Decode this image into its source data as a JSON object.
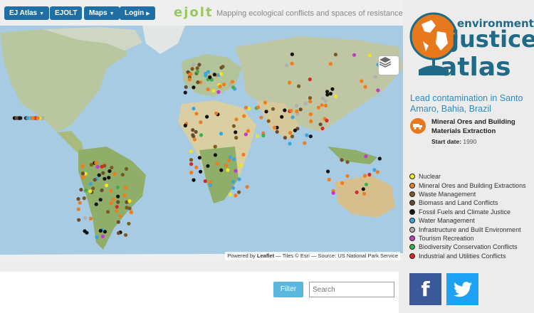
{
  "nav": {
    "ej_atlas": "EJ Atlas",
    "ejolt": "EJOLT",
    "maps": "Maps",
    "login": "Login"
  },
  "header": {
    "logo": "ejolt",
    "tagline": "Mapping ecological conflicts and spaces of resistance"
  },
  "map": {
    "layers_icon": "layers-icon",
    "attribution_prefix": "Powered by ",
    "attribution_leaflet": "Leaflet",
    "attribution_rest": " — Tiles © Esri — Source: US National Park Service"
  },
  "sidebar": {
    "logo_lines": [
      "environmental",
      "justice",
      "atlas"
    ],
    "conflict_title": "Lead contamination in Santo Amaro, Bahia, Brazil",
    "category": "Mineral Ores and Building Materials Extraction",
    "category_icon": "mining-truck-icon",
    "start_date_label": "Start date:",
    "start_date_value": "1990"
  },
  "legend": [
    {
      "label": "Nuclear",
      "color": "#f2e51b"
    },
    {
      "label": "Mineral Ores and Building Extractions",
      "color": "#f07c1c"
    },
    {
      "label": "Waste Management",
      "color": "#7a5a20"
    },
    {
      "label": "Biomass and Land Conflicts",
      "color": "#6b4a2e"
    },
    {
      "label": "Fossil Fuels and Climate Justice",
      "color": "#111111"
    },
    {
      "label": "Water Management",
      "color": "#3aa6e0"
    },
    {
      "label": "Infrastructure and Built Environment",
      "color": "#b0b0b0"
    },
    {
      "label": "Tourism Recreation",
      "color": "#c43ac8"
    },
    {
      "label": "Biodiversity Conservation Conflicts",
      "color": "#3ab14a"
    },
    {
      "label": "Industrial and Utilities Conflicts",
      "color": "#d42a2a"
    }
  ],
  "search": {
    "filter_label": "Filter",
    "placeholder": "Search"
  },
  "social": {
    "facebook_glyph": "f"
  }
}
